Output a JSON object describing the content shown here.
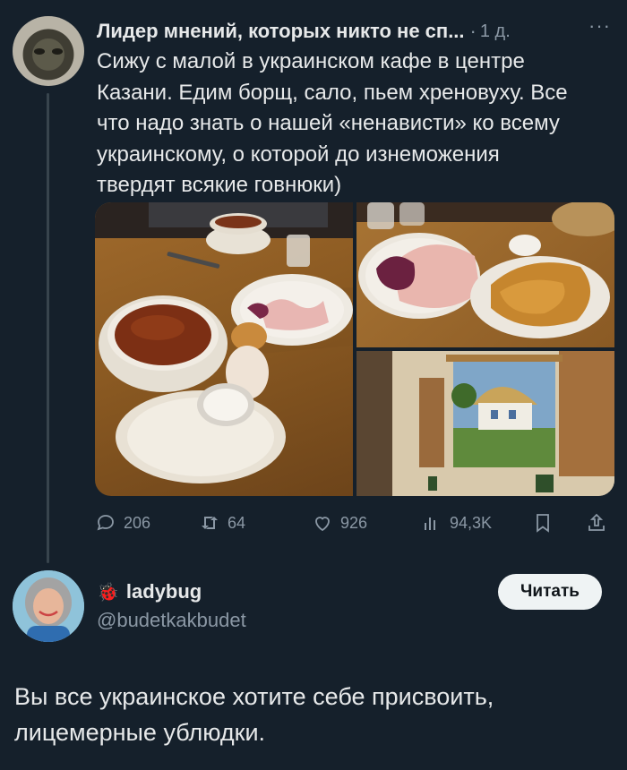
{
  "tweet": {
    "author_name": "Лидер мнений, которых никто не сп...",
    "separator": "·",
    "time": "1 д.",
    "more": "···",
    "text_lines": [
      "Сижу с малой в украинском кафе в центре",
      "Казани. Едим борщ, сало, пьем хреновуху. Все",
      "что надо знать о нашей «ненависти» ко всему",
      "украинскому, о которой до изнеможения",
      "твердят всякие говнюки)"
    ]
  },
  "actions": {
    "replies": "206",
    "retweets": "64",
    "likes": "926",
    "views": "94,3K"
  },
  "reply": {
    "emoji": "🐞",
    "name": "ladybug",
    "handle": "@budetkakbudet",
    "follow_label": "Читать",
    "text_lines": [
      "Вы все украинское хотите себе присвоить,",
      "лицемерные ублюдки."
    ]
  },
  "colors": {
    "background": "#15202b",
    "text": "#e7e9ea",
    "secondary": "#8b98a5",
    "follow_bg": "#eff3f4"
  }
}
